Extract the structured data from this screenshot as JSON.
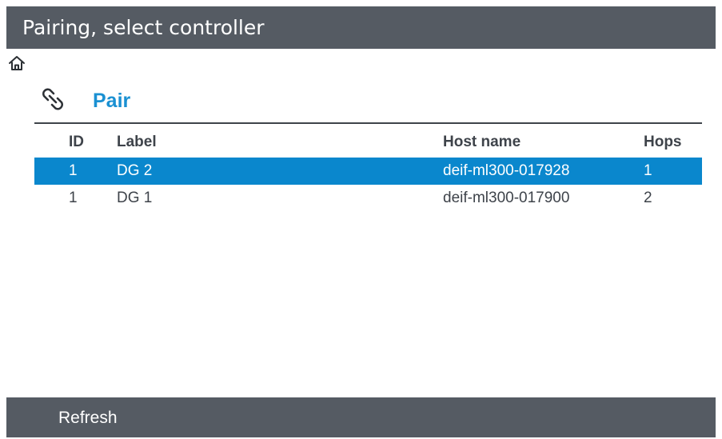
{
  "window": {
    "title": "Pairing, select controller"
  },
  "section": {
    "title": "Pair",
    "icon": "link-icon"
  },
  "nav": {
    "home_icon": "home-icon"
  },
  "table": {
    "columns": {
      "id": "ID",
      "label": "Label",
      "host": "Host name",
      "hops": "Hops"
    },
    "rows": [
      {
        "id": "1",
        "label": "DG 2",
        "host": "deif-ml300-017928",
        "hops": "1",
        "selected": true
      },
      {
        "id": "1",
        "label": "DG 1",
        "host": "deif-ml300-017900",
        "hops": "2",
        "selected": false
      }
    ]
  },
  "footer": {
    "refresh_label": "Refresh"
  },
  "colors": {
    "bar": "#555b63",
    "accent": "#1a90d2",
    "selection": "#0a87cd",
    "text": "#3e434a"
  }
}
